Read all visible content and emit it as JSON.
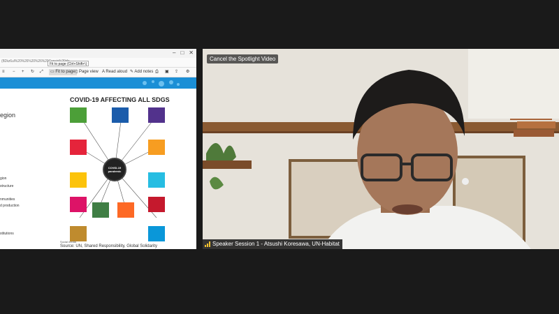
{
  "share": {
    "tooltip": "Fit to page (Ctrl+Shift+\\)",
    "address_fragment": "(B2kz6uI%20%26%20%26%20Consis%20rfe",
    "toolbar": {
      "fit_label": "Fit to page",
      "page_view_label": "Page view",
      "read_aloud_label": "Read aloud",
      "add_notes_label": "Add notes"
    },
    "side_labels": [
      "egion",
      "gion",
      "structure",
      "nmunities",
      "d production",
      "stitutions"
    ],
    "figure_title": "COVID-19 AFFECTING ALL SDGS",
    "center_label": "COVID-19 pandemic",
    "source_top": "Social media",
    "source": "Source: UN, Shared Responsibility, Global Solidarity"
  },
  "video": {
    "spotlight_button": "Cancel the Spotlight Video",
    "speaker_label": "Speaker Session 1 - Atsushi Koresawa, UN-Habitat"
  },
  "colors": {
    "background": "#1a1a1a",
    "speaker_bar": "#141414",
    "signal": "#f2c230",
    "accent_blue": "#1b8fd6"
  },
  "sdg_colors": [
    "#4c9f38",
    "#1b5cab",
    "#52328c",
    "#e5243b",
    "#f79d21",
    "#fcc30b",
    "#26bde2",
    "#dd1367",
    "#c5192d",
    "#3f7e44",
    "#fd6925",
    "#bf8b2e",
    "#0a97d9",
    "#ff3a21"
  ]
}
